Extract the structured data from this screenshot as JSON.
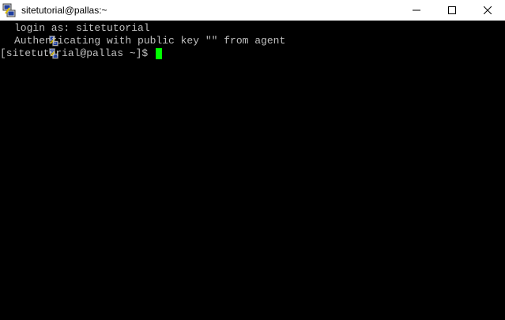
{
  "window": {
    "title": "sitetutorial@pallas:~",
    "icon": "putty-icon",
    "controls": [
      "minimize",
      "maximize",
      "close"
    ]
  },
  "terminal": {
    "lines": [
      {
        "icon": "putty-small-icon",
        "text": "login as: sitetutorial"
      },
      {
        "icon": "putty-small-icon",
        "text": "Authenticating with public key \"\" from agent"
      }
    ],
    "prompt": "[sitetutorial@pallas ~]$ ",
    "colors": {
      "background": "#000000",
      "foreground": "#c0c0c0",
      "cursor": "#00ff00"
    }
  }
}
